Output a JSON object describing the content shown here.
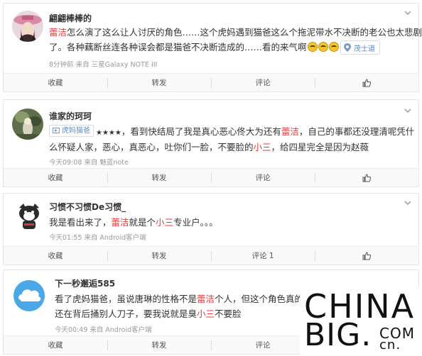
{
  "comments": [
    {
      "username": "翩翩棒棒的",
      "text_line1": [
        "",
        "蕾洁",
        "怎么演了这么让人讨厌的角色……这个虎妈遇到猫爸这么个拖泥带水不决断的老公也太悲剧"
      ],
      "text_line2": "了。各种藕断丝连各种误会都是猫爸不决断造成的……看的来气啊",
      "location": "茂士道",
      "meta": "8分钟前 来自 三星Galaxy NOTE III",
      "actions": {
        "favorite": "收藏",
        "repost": "转发",
        "comment": "评论"
      }
    },
    {
      "username": "谁家的珂珂",
      "movie_tag": "虎妈猫爸",
      "stars": "★★★★",
      "text_line1": [
        "，看到快结局了我是真心恶心佟大为还有",
        "蕾洁",
        "，自己的事都还没理清呢凭什"
      ],
      "text_line2": [
        "么怀疑人家，恶心，真恶心，吐你们一脸，不要脸的",
        "小三",
        "，给四星完全是因为赵薇"
      ],
      "meta": "今天09:08 来自 魅蓝note",
      "actions": {
        "favorite": "收藏",
        "repost": "转发",
        "comment": "评论"
      }
    },
    {
      "username": "习惯不习惯De习惯_",
      "text_line1": [
        "我是看出来了，",
        "蕾洁",
        "就是个",
        "小三",
        "专业户。。。"
      ],
      "meta": "今天01:55 来自 Android客户端",
      "actions": {
        "favorite": "收藏",
        "repost": "转发",
        "comment": "评论 1"
      }
    },
    {
      "username": "下一秒邂逅585",
      "text_line1": [
        "看了虎妈猫爸，虽说唐琳的性格不是",
        "蕾洁",
        "个人，但这个角色真的是"
      ],
      "text_line2": [
        "还在背后捅别人刀子，要我说就是臭",
        "小三",
        "不要脸"
      ],
      "meta": "今天00:49 来自 Android客户端",
      "actions": {
        "favorite": "收藏",
        "repost": "转发",
        "comment": "评论"
      }
    }
  ],
  "watermark": {
    "line1": "CHINA",
    "line2": "BIG",
    "dot": ".",
    "suffix_top": "COM",
    "suffix_bottom": "cn"
  },
  "colors": {
    "highlight": "#e4393c",
    "link": "#5a8ac6",
    "meta": "#999999"
  },
  "icons": [
    "chevron-down-icon",
    "thumbs-up-icon",
    "location-pin-icon",
    "smiley-emoji-icon"
  ]
}
